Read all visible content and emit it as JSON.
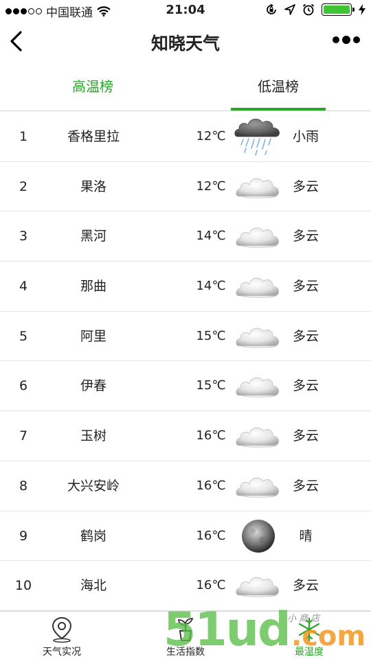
{
  "status_bar": {
    "carrier": "中国联通",
    "time": "21:04",
    "battery_color": "#3fc534"
  },
  "nav": {
    "title": "知晓天气"
  },
  "tabs": [
    {
      "label": "高温榜",
      "active": false
    },
    {
      "label": "低温榜",
      "active": true
    }
  ],
  "colors": {
    "accent": "#2aa52a"
  },
  "rows": [
    {
      "rank": "1",
      "city": "香格里拉",
      "temp": "12℃",
      "icon": "light-rain",
      "condition": "小雨"
    },
    {
      "rank": "2",
      "city": "果洛",
      "temp": "12℃",
      "icon": "cloudy",
      "condition": "多云"
    },
    {
      "rank": "3",
      "city": "黑河",
      "temp": "14℃",
      "icon": "cloudy",
      "condition": "多云"
    },
    {
      "rank": "4",
      "city": "那曲",
      "temp": "14℃",
      "icon": "cloudy",
      "condition": "多云"
    },
    {
      "rank": "5",
      "city": "阿里",
      "temp": "15℃",
      "icon": "cloudy",
      "condition": "多云"
    },
    {
      "rank": "6",
      "city": "伊春",
      "temp": "15℃",
      "icon": "cloudy",
      "condition": "多云"
    },
    {
      "rank": "7",
      "city": "玉树",
      "temp": "16℃",
      "icon": "cloudy",
      "condition": "多云"
    },
    {
      "rank": "8",
      "city": "大兴安岭",
      "temp": "16℃",
      "icon": "cloudy",
      "condition": "多云"
    },
    {
      "rank": "9",
      "city": "鹤岗",
      "temp": "16℃",
      "icon": "clear-night",
      "condition": "晴"
    },
    {
      "rank": "10",
      "city": "海北",
      "temp": "16℃",
      "icon": "cloudy",
      "condition": "多云"
    }
  ],
  "tab_bar": [
    {
      "label": "天气实况",
      "icon": "location-pin-icon"
    },
    {
      "label": "生活指数",
      "icon": "plant-pot-icon"
    },
    {
      "label": "最温度",
      "icon": "snowflake-icon"
    }
  ],
  "watermark": {
    "text": "51ud",
    "suffix": ".com",
    "shop": "小 商 店"
  }
}
